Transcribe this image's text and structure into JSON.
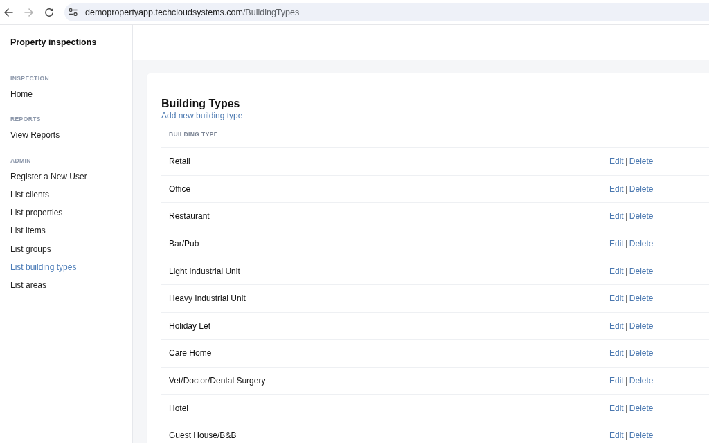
{
  "browser": {
    "nav_buttons": [
      {
        "kind": "back",
        "disabled": false
      },
      {
        "kind": "forward",
        "disabled": true
      },
      {
        "kind": "reload",
        "disabled": false
      }
    ],
    "url": {
      "host": "demopropertyapp.techcloudsystems.com",
      "path": "/BuildingTypes"
    }
  },
  "sidebar": {
    "title": "Property inspections",
    "sections": [
      {
        "heading": "INSPECTION",
        "items": [
          {
            "label": "Home",
            "selected": false
          }
        ]
      },
      {
        "heading": "REPORTS",
        "items": [
          {
            "label": "View Reports",
            "selected": false
          }
        ]
      },
      {
        "heading": "ADMIN",
        "items": [
          {
            "label": "Register a New User",
            "selected": false
          },
          {
            "label": "List clients",
            "selected": false
          },
          {
            "label": "List properties",
            "selected": false
          },
          {
            "label": "List items",
            "selected": false
          },
          {
            "label": "List groups",
            "selected": false
          },
          {
            "label": "List building types",
            "selected": true
          },
          {
            "label": "List areas",
            "selected": false
          }
        ]
      }
    ]
  },
  "page": {
    "title": "Building Types",
    "add_link": "Add new building type",
    "table": {
      "columns": [
        "BUILDING TYPE"
      ],
      "rows": [
        {
          "building_type": "Retail",
          "edit": "Edit",
          "separator": "|",
          "delete": "Delete"
        },
        {
          "building_type": "Office",
          "edit": "Edit",
          "separator": "|",
          "delete": "Delete"
        },
        {
          "building_type": "Restaurant",
          "edit": "Edit",
          "separator": "|",
          "delete": "Delete"
        },
        {
          "building_type": "Bar/Pub",
          "edit": "Edit",
          "separator": "|",
          "delete": "Delete"
        },
        {
          "building_type": "Light Industrial Unit",
          "edit": "Edit",
          "separator": "|",
          "delete": "Delete"
        },
        {
          "building_type": "Heavy Industrial Unit",
          "edit": "Edit",
          "separator": "|",
          "delete": "Delete"
        },
        {
          "building_type": "Holiday Let",
          "edit": "Edit",
          "separator": "|",
          "delete": "Delete"
        },
        {
          "building_type": "Care Home",
          "edit": "Edit",
          "separator": "|",
          "delete": "Delete"
        },
        {
          "building_type": "Vet/Doctor/Dental Surgery",
          "edit": "Edit",
          "separator": "|",
          "delete": "Delete"
        },
        {
          "building_type": "Hotel",
          "edit": "Edit",
          "separator": "|",
          "delete": "Delete"
        },
        {
          "building_type": "Guest House/B&B",
          "edit": "Edit",
          "separator": "|",
          "delete": "Delete"
        }
      ]
    }
  }
}
